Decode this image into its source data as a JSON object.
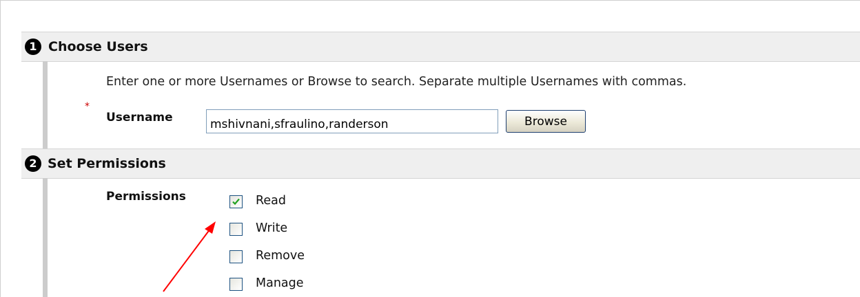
{
  "steps": [
    {
      "number": "1",
      "title": "Choose Users"
    },
    {
      "number": "2",
      "title": "Set Permissions"
    }
  ],
  "choose_users": {
    "instructions": "Enter one or more Usernames or Browse to search. Separate multiple Usernames with commas.",
    "required_marker": "*",
    "username_label": "Username",
    "username_value": "mshivnani,sfraulino,randerson",
    "browse_label": "Browse"
  },
  "permissions": {
    "label": "Permissions",
    "items": [
      {
        "label": "Read",
        "checked": true
      },
      {
        "label": "Write",
        "checked": false
      },
      {
        "label": "Remove",
        "checked": false
      },
      {
        "label": "Manage",
        "checked": false
      }
    ]
  },
  "colors": {
    "header_background": "#efefef",
    "checkmark": "#21a121",
    "annotation_arrow": "#ff0000",
    "required_marker": "#cc0000"
  },
  "icons": {
    "checkbox_checked": "checkmark-icon",
    "annotation": "red-arrow-icon"
  }
}
